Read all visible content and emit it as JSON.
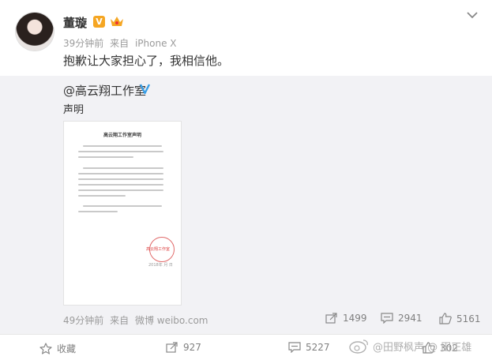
{
  "post": {
    "author": "董璇",
    "verified_badge": "V",
    "time": "39分钟前",
    "source_prefix": "来自",
    "source": "iPhone X",
    "text": "抱歉让大家担心了，我相信他。"
  },
  "repost": {
    "author": "@高云翔工作室",
    "text": "声明",
    "document": {
      "title": "高云翔工作室声明",
      "seal_text": "高云翔工作室",
      "date": "2018年 月 日"
    },
    "time": "49分钟前",
    "source_prefix": "来自",
    "source": "微博 weibo.com",
    "reposts": "1499",
    "comments": "2941",
    "likes": "5161"
  },
  "actions": {
    "favorite_label": "收藏",
    "repost_count": "927",
    "comment_count": "5227",
    "like_count": "302"
  },
  "watermark": "@田野枫声 @ 田正雄",
  "colors": {
    "accent_orange": "#f5a623",
    "verified_blue": "#3aa0e8",
    "meta_gray": "#9b9b9b"
  }
}
